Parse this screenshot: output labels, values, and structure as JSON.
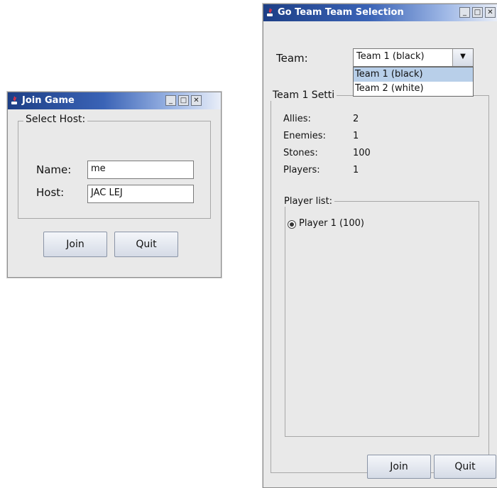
{
  "join_window": {
    "title": "Join Game",
    "group_title": "Select Host:",
    "name_label": "Name:",
    "name_value": "me",
    "host_label": "Host:",
    "host_value": "JAC LEJ",
    "join_label": "Join",
    "quit_label": "Quit"
  },
  "team_window": {
    "title": "Go Team Team Selection",
    "team_label": "Team:",
    "team_selected": "Team 1 (black)",
    "team_options": [
      "Team 1 (black)",
      "Team 2 (white)"
    ],
    "settings_group_title": "Team 1 Setti",
    "stats": [
      {
        "label": "Allies:",
        "value": "2"
      },
      {
        "label": "Enemies:",
        "value": "1"
      },
      {
        "label": "Stones:",
        "value": "100"
      },
      {
        "label": "Players:",
        "value": "1"
      }
    ],
    "player_list_title": "Player list:",
    "players": [
      "Player 1 (100)"
    ],
    "join_label": "Join",
    "quit_label": "Quit"
  }
}
